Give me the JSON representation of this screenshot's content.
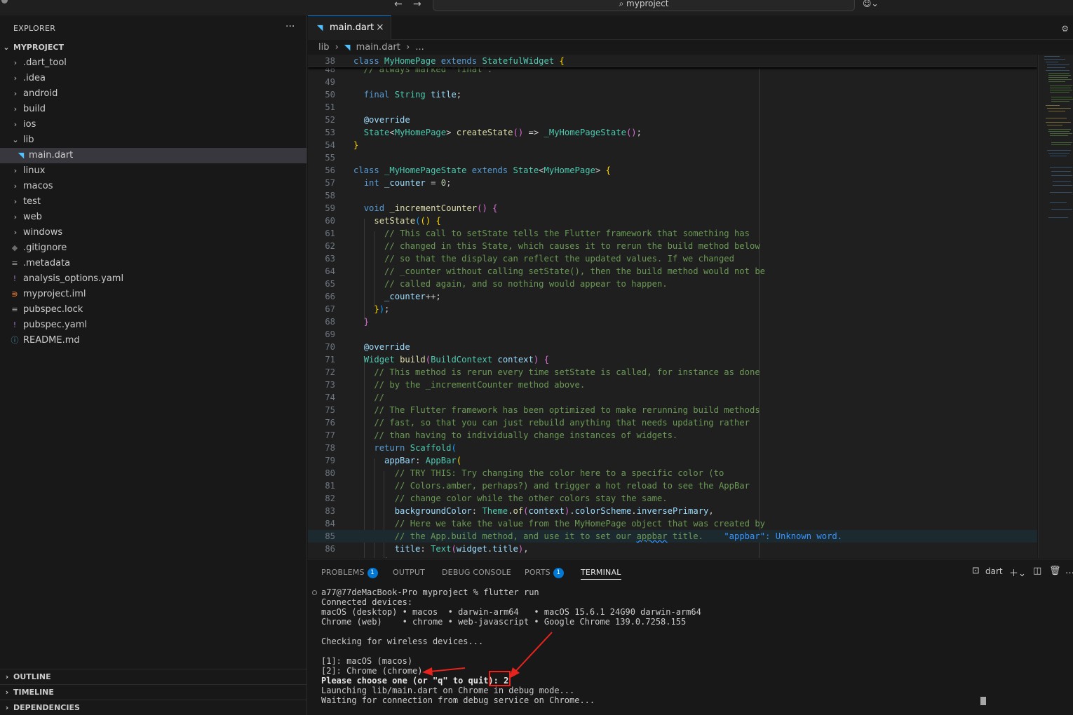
{
  "titlebar": {
    "back_icon": "arrow-left-icon",
    "forward_icon": "arrow-right-icon",
    "search_text": "myproject",
    "copilot_icon": "copilot-icon"
  },
  "sidebar": {
    "header": "EXPLORER",
    "more": "···",
    "root": "MYPROJECT",
    "items": [
      {
        "label": ".dart_tool",
        "kind": "folder",
        "open": false
      },
      {
        "label": ".idea",
        "kind": "folder",
        "open": false
      },
      {
        "label": "android",
        "kind": "folder",
        "open": false
      },
      {
        "label": "build",
        "kind": "folder",
        "open": false
      },
      {
        "label": "ios",
        "kind": "folder",
        "open": false
      },
      {
        "label": "lib",
        "kind": "folder",
        "open": true
      },
      {
        "label": "main.dart",
        "kind": "dart",
        "selected": true
      },
      {
        "label": "linux",
        "kind": "folder",
        "open": false
      },
      {
        "label": "macos",
        "kind": "folder",
        "open": false
      },
      {
        "label": "test",
        "kind": "folder",
        "open": false
      },
      {
        "label": "web",
        "kind": "folder",
        "open": false
      },
      {
        "label": "windows",
        "kind": "folder",
        "open": false
      },
      {
        "label": ".gitignore",
        "kind": "git"
      },
      {
        "label": ".metadata",
        "kind": "lines"
      },
      {
        "label": "analysis_options.yaml",
        "kind": "yaml"
      },
      {
        "label": "myproject.iml",
        "kind": "rss"
      },
      {
        "label": "pubspec.lock",
        "kind": "lines"
      },
      {
        "label": "pubspec.yaml",
        "kind": "yaml"
      },
      {
        "label": "README.md",
        "kind": "info"
      }
    ],
    "sections": [
      "OUTLINE",
      "TIMELINE",
      "DEPENDENCIES"
    ]
  },
  "editor": {
    "tab_label": "main.dart",
    "tab_close": "×",
    "breadcrumb": [
      "lib",
      "›",
      "main.dart",
      "›",
      "..."
    ],
    "diagnostic_word": "\"appbar\": Unknown word."
  },
  "panel": {
    "tabs": [
      {
        "label": "PROBLEMS",
        "badge": "1"
      },
      {
        "label": "OUTPUT",
        "badge": ""
      },
      {
        "label": "DEBUG CONSOLE",
        "badge": ""
      },
      {
        "label": "PORTS",
        "badge": "1"
      },
      {
        "label": "TERMINAL",
        "badge": ""
      }
    ],
    "terminal_name": "dart",
    "terminal_lines": [
      {
        "text": "a77@77deMacBook-Pro myproject % flutter run",
        "bold": false
      },
      {
        "text": "Connected devices:",
        "bold": false
      },
      {
        "text": "macOS (desktop) • macos  • darwin-arm64   • macOS 15.6.1 24G90 darwin-arm64",
        "bold": false
      },
      {
        "text": "Chrome (web)    • chrome • web-javascript • Google Chrome 139.0.7258.155",
        "bold": false
      },
      {
        "text": "",
        "bold": false
      },
      {
        "text": "Checking for wireless devices...",
        "bold": false
      },
      {
        "text": "",
        "bold": false
      },
      {
        "text": "[1]: macOS (macos)",
        "bold": false
      },
      {
        "text": "[2]: Chrome (chrome)",
        "bold": false
      },
      {
        "text": "Please choose one (or \"q\" to quit): 2",
        "bold": true
      },
      {
        "text": "Launching lib/main.dart on Chrome in debug mode...",
        "bold": false
      },
      {
        "text": "Waiting for connection from debug service on Chrome...",
        "bold": false
      }
    ]
  },
  "colors": {
    "accent": "#0078d4",
    "annotation": "#e8231e"
  }
}
